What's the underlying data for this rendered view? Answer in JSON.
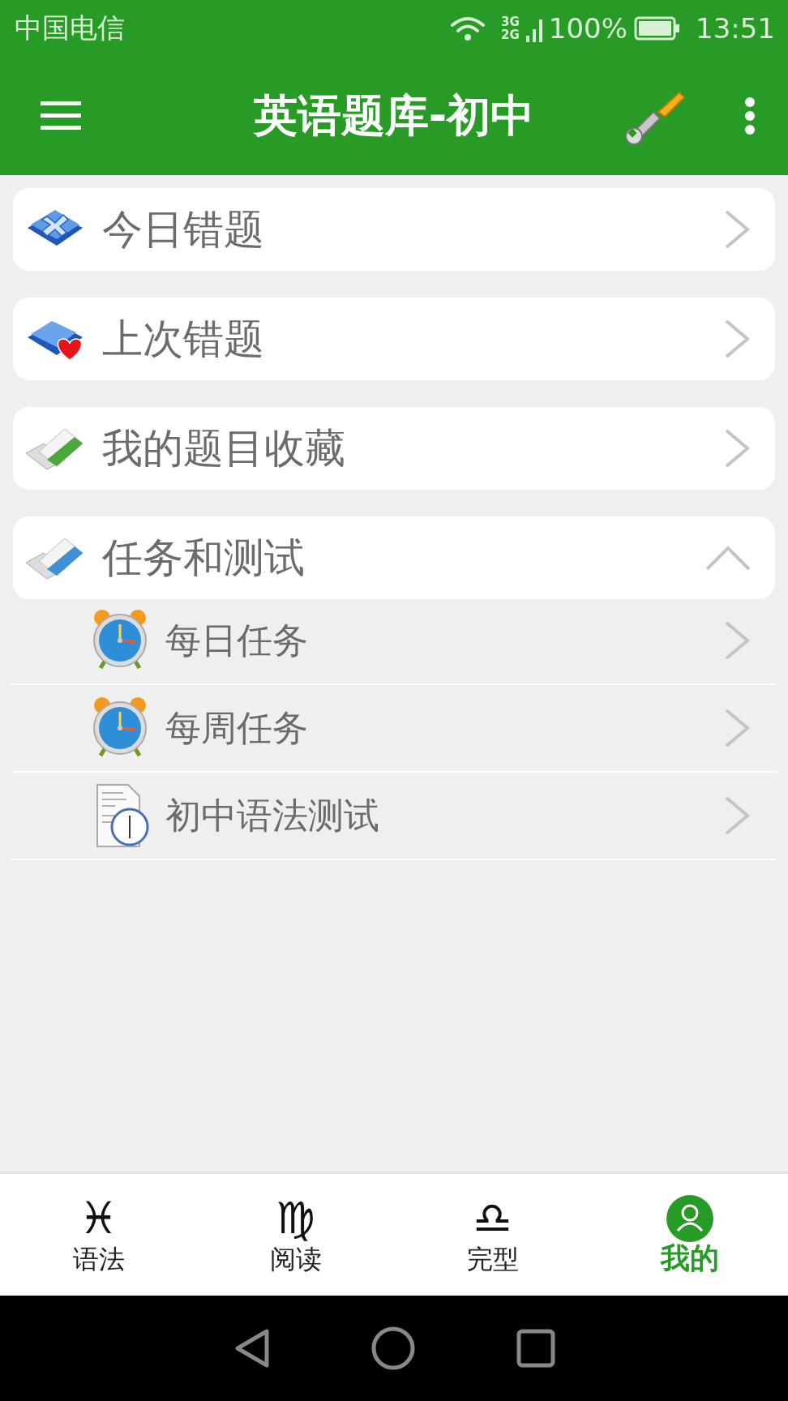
{
  "status_bar": {
    "carrier": "中国电信",
    "network_top": "3G",
    "network_bottom": "2G",
    "battery": "100%",
    "time": "13:51"
  },
  "app_bar": {
    "title": "英语题库-初中"
  },
  "menu": [
    {
      "kind": "link",
      "label": "今日错题"
    },
    {
      "kind": "link",
      "label": "上次错题"
    },
    {
      "kind": "link",
      "label": "我的题目收藏"
    },
    {
      "kind": "group",
      "label": "任务和测试",
      "expanded": true,
      "children": [
        {
          "label": "每日任务"
        },
        {
          "label": "每周任务"
        },
        {
          "label": "初中语法测试"
        }
      ]
    }
  ],
  "tabs": [
    {
      "icon": "♓",
      "label": "语法",
      "selected": false
    },
    {
      "icon": "♍",
      "label": "阅读",
      "selected": false
    },
    {
      "icon": "♎",
      "label": "完型",
      "selected": false
    },
    {
      "label": "我的",
      "selected": true
    }
  ]
}
